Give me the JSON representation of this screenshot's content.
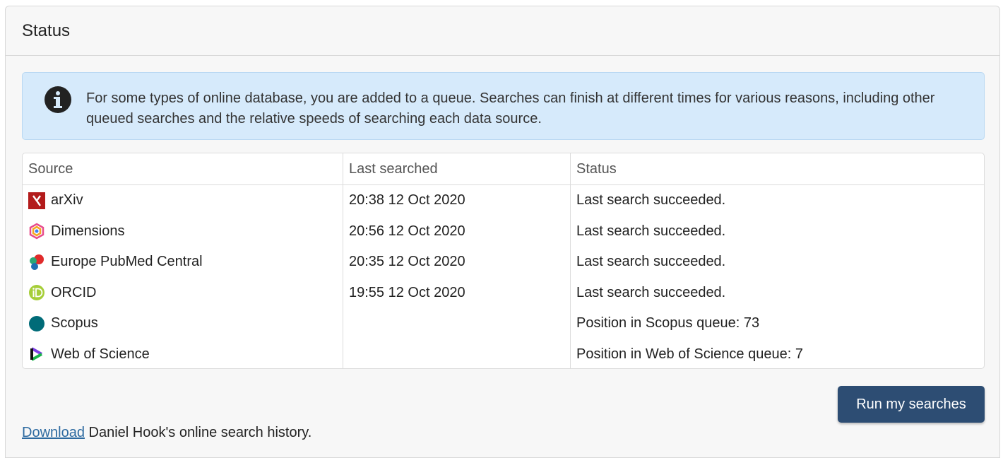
{
  "panel": {
    "title": "Status"
  },
  "alert": {
    "icon": "info-icon",
    "text": "For some types of online database, you are added to a queue. Searches can finish at different times for various reasons, including other queued searches and the relative speeds of searching each data source."
  },
  "table": {
    "headers": [
      "Source",
      "Last searched",
      "Status"
    ],
    "rows": [
      {
        "source": "arXiv",
        "icon": "arxiv-icon",
        "last_searched": "20:38 12 Oct 2020",
        "status": "Last search succeeded."
      },
      {
        "source": "Dimensions",
        "icon": "dimensions-icon",
        "last_searched": "20:56 12 Oct 2020",
        "status": "Last search succeeded."
      },
      {
        "source": "Europe PubMed Central",
        "icon": "europe-pmc-icon",
        "last_searched": "20:35 12 Oct 2020",
        "status": "Last search succeeded."
      },
      {
        "source": "ORCID",
        "icon": "orcid-icon",
        "last_searched": "19:55 12 Oct 2020",
        "status": "Last search succeeded."
      },
      {
        "source": "Scopus",
        "icon": "scopus-icon",
        "last_searched": "",
        "status": "Position in Scopus queue: 73"
      },
      {
        "source": "Web of Science",
        "icon": "web-of-science-icon",
        "last_searched": "",
        "status": "Position in Web of Science queue: 7"
      }
    ]
  },
  "actions": {
    "run_label": "Run my searches"
  },
  "footer": {
    "link_label": "Download",
    "text": " Daniel Hook's online search history."
  },
  "colors": {
    "button": "#2d4d73",
    "alert_bg": "#d6eafb",
    "link": "#2d6aa0"
  }
}
